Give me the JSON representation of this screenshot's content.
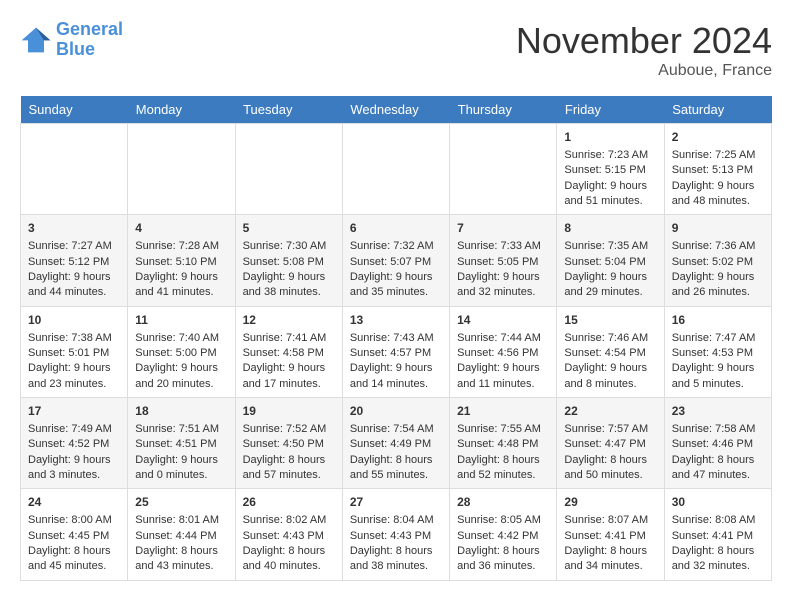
{
  "logo": {
    "line1": "General",
    "line2": "Blue"
  },
  "title": "November 2024",
  "location": "Auboue, France",
  "days_of_week": [
    "Sunday",
    "Monday",
    "Tuesday",
    "Wednesday",
    "Thursday",
    "Friday",
    "Saturday"
  ],
  "weeks": [
    [
      {
        "day": "",
        "info": ""
      },
      {
        "day": "",
        "info": ""
      },
      {
        "day": "",
        "info": ""
      },
      {
        "day": "",
        "info": ""
      },
      {
        "day": "",
        "info": ""
      },
      {
        "day": "1",
        "info": "Sunrise: 7:23 AM\nSunset: 5:15 PM\nDaylight: 9 hours and 51 minutes."
      },
      {
        "day": "2",
        "info": "Sunrise: 7:25 AM\nSunset: 5:13 PM\nDaylight: 9 hours and 48 minutes."
      }
    ],
    [
      {
        "day": "3",
        "info": "Sunrise: 7:27 AM\nSunset: 5:12 PM\nDaylight: 9 hours and 44 minutes."
      },
      {
        "day": "4",
        "info": "Sunrise: 7:28 AM\nSunset: 5:10 PM\nDaylight: 9 hours and 41 minutes."
      },
      {
        "day": "5",
        "info": "Sunrise: 7:30 AM\nSunset: 5:08 PM\nDaylight: 9 hours and 38 minutes."
      },
      {
        "day": "6",
        "info": "Sunrise: 7:32 AM\nSunset: 5:07 PM\nDaylight: 9 hours and 35 minutes."
      },
      {
        "day": "7",
        "info": "Sunrise: 7:33 AM\nSunset: 5:05 PM\nDaylight: 9 hours and 32 minutes."
      },
      {
        "day": "8",
        "info": "Sunrise: 7:35 AM\nSunset: 5:04 PM\nDaylight: 9 hours and 29 minutes."
      },
      {
        "day": "9",
        "info": "Sunrise: 7:36 AM\nSunset: 5:02 PM\nDaylight: 9 hours and 26 minutes."
      }
    ],
    [
      {
        "day": "10",
        "info": "Sunrise: 7:38 AM\nSunset: 5:01 PM\nDaylight: 9 hours and 23 minutes."
      },
      {
        "day": "11",
        "info": "Sunrise: 7:40 AM\nSunset: 5:00 PM\nDaylight: 9 hours and 20 minutes."
      },
      {
        "day": "12",
        "info": "Sunrise: 7:41 AM\nSunset: 4:58 PM\nDaylight: 9 hours and 17 minutes."
      },
      {
        "day": "13",
        "info": "Sunrise: 7:43 AM\nSunset: 4:57 PM\nDaylight: 9 hours and 14 minutes."
      },
      {
        "day": "14",
        "info": "Sunrise: 7:44 AM\nSunset: 4:56 PM\nDaylight: 9 hours and 11 minutes."
      },
      {
        "day": "15",
        "info": "Sunrise: 7:46 AM\nSunset: 4:54 PM\nDaylight: 9 hours and 8 minutes."
      },
      {
        "day": "16",
        "info": "Sunrise: 7:47 AM\nSunset: 4:53 PM\nDaylight: 9 hours and 5 minutes."
      }
    ],
    [
      {
        "day": "17",
        "info": "Sunrise: 7:49 AM\nSunset: 4:52 PM\nDaylight: 9 hours and 3 minutes."
      },
      {
        "day": "18",
        "info": "Sunrise: 7:51 AM\nSunset: 4:51 PM\nDaylight: 9 hours and 0 minutes."
      },
      {
        "day": "19",
        "info": "Sunrise: 7:52 AM\nSunset: 4:50 PM\nDaylight: 8 hours and 57 minutes."
      },
      {
        "day": "20",
        "info": "Sunrise: 7:54 AM\nSunset: 4:49 PM\nDaylight: 8 hours and 55 minutes."
      },
      {
        "day": "21",
        "info": "Sunrise: 7:55 AM\nSunset: 4:48 PM\nDaylight: 8 hours and 52 minutes."
      },
      {
        "day": "22",
        "info": "Sunrise: 7:57 AM\nSunset: 4:47 PM\nDaylight: 8 hours and 50 minutes."
      },
      {
        "day": "23",
        "info": "Sunrise: 7:58 AM\nSunset: 4:46 PM\nDaylight: 8 hours and 47 minutes."
      }
    ],
    [
      {
        "day": "24",
        "info": "Sunrise: 8:00 AM\nSunset: 4:45 PM\nDaylight: 8 hours and 45 minutes."
      },
      {
        "day": "25",
        "info": "Sunrise: 8:01 AM\nSunset: 4:44 PM\nDaylight: 8 hours and 43 minutes."
      },
      {
        "day": "26",
        "info": "Sunrise: 8:02 AM\nSunset: 4:43 PM\nDaylight: 8 hours and 40 minutes."
      },
      {
        "day": "27",
        "info": "Sunrise: 8:04 AM\nSunset: 4:43 PM\nDaylight: 8 hours and 38 minutes."
      },
      {
        "day": "28",
        "info": "Sunrise: 8:05 AM\nSunset: 4:42 PM\nDaylight: 8 hours and 36 minutes."
      },
      {
        "day": "29",
        "info": "Sunrise: 8:07 AM\nSunset: 4:41 PM\nDaylight: 8 hours and 34 minutes."
      },
      {
        "day": "30",
        "info": "Sunrise: 8:08 AM\nSunset: 4:41 PM\nDaylight: 8 hours and 32 minutes."
      }
    ]
  ]
}
